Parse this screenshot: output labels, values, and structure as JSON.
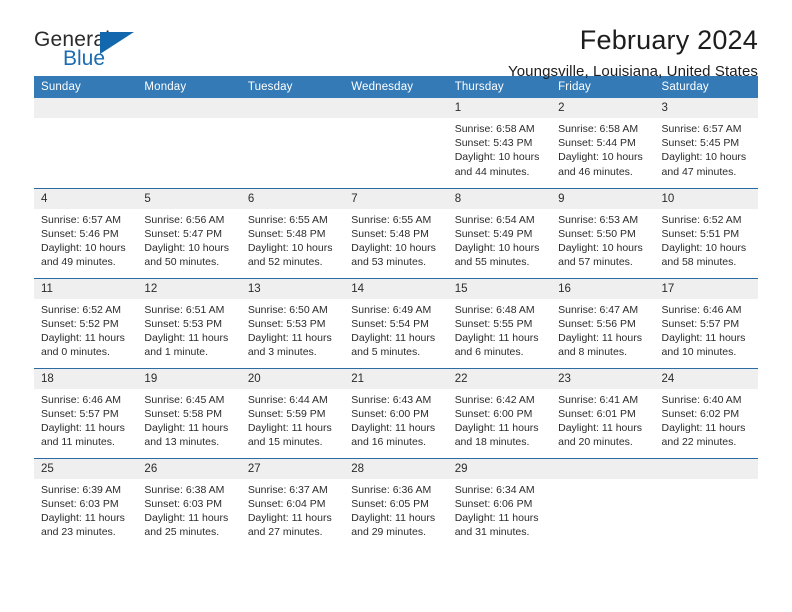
{
  "brand": {
    "name_line1": "General",
    "name_line2": "Blue",
    "logo_icon": "triangle-icon",
    "accent_color": "#1267ad"
  },
  "header": {
    "title": "February 2024",
    "subtitle": "Youngsville, Louisiana, United States"
  },
  "theme": {
    "header_row_bg": "#337ab7",
    "header_row_text": "#ffffff",
    "row_divider": "#2b6ca3",
    "daynum_bg": "#efefef",
    "body_text": "#2b2b2b"
  },
  "calendar": {
    "weekday_headers": [
      "Sunday",
      "Monday",
      "Tuesday",
      "Wednesday",
      "Thursday",
      "Friday",
      "Saturday"
    ],
    "labels": {
      "sunrise": "Sunrise:",
      "sunset": "Sunset:",
      "daylight": "Daylight:"
    },
    "weeks": [
      [
        {
          "day": "",
          "sunrise": "",
          "sunset": "",
          "daylight_line1": "",
          "daylight_line2": "",
          "empty": true
        },
        {
          "day": "",
          "sunrise": "",
          "sunset": "",
          "daylight_line1": "",
          "daylight_line2": "",
          "empty": true
        },
        {
          "day": "",
          "sunrise": "",
          "sunset": "",
          "daylight_line1": "",
          "daylight_line2": "",
          "empty": true
        },
        {
          "day": "",
          "sunrise": "",
          "sunset": "",
          "daylight_line1": "",
          "daylight_line2": "",
          "empty": true
        },
        {
          "day": "1",
          "sunrise": "Sunrise: 6:58 AM",
          "sunset": "Sunset: 5:43 PM",
          "daylight_line1": "Daylight: 10 hours",
          "daylight_line2": "and 44 minutes.",
          "empty": false
        },
        {
          "day": "2",
          "sunrise": "Sunrise: 6:58 AM",
          "sunset": "Sunset: 5:44 PM",
          "daylight_line1": "Daylight: 10 hours",
          "daylight_line2": "and 46 minutes.",
          "empty": false
        },
        {
          "day": "3",
          "sunrise": "Sunrise: 6:57 AM",
          "sunset": "Sunset: 5:45 PM",
          "daylight_line1": "Daylight: 10 hours",
          "daylight_line2": "and 47 minutes.",
          "empty": false
        }
      ],
      [
        {
          "day": "4",
          "sunrise": "Sunrise: 6:57 AM",
          "sunset": "Sunset: 5:46 PM",
          "daylight_line1": "Daylight: 10 hours",
          "daylight_line2": "and 49 minutes.",
          "empty": false
        },
        {
          "day": "5",
          "sunrise": "Sunrise: 6:56 AM",
          "sunset": "Sunset: 5:47 PM",
          "daylight_line1": "Daylight: 10 hours",
          "daylight_line2": "and 50 minutes.",
          "empty": false
        },
        {
          "day": "6",
          "sunrise": "Sunrise: 6:55 AM",
          "sunset": "Sunset: 5:48 PM",
          "daylight_line1": "Daylight: 10 hours",
          "daylight_line2": "and 52 minutes.",
          "empty": false
        },
        {
          "day": "7",
          "sunrise": "Sunrise: 6:55 AM",
          "sunset": "Sunset: 5:48 PM",
          "daylight_line1": "Daylight: 10 hours",
          "daylight_line2": "and 53 minutes.",
          "empty": false
        },
        {
          "day": "8",
          "sunrise": "Sunrise: 6:54 AM",
          "sunset": "Sunset: 5:49 PM",
          "daylight_line1": "Daylight: 10 hours",
          "daylight_line2": "and 55 minutes.",
          "empty": false
        },
        {
          "day": "9",
          "sunrise": "Sunrise: 6:53 AM",
          "sunset": "Sunset: 5:50 PM",
          "daylight_line1": "Daylight: 10 hours",
          "daylight_line2": "and 57 minutes.",
          "empty": false
        },
        {
          "day": "10",
          "sunrise": "Sunrise: 6:52 AM",
          "sunset": "Sunset: 5:51 PM",
          "daylight_line1": "Daylight: 10 hours",
          "daylight_line2": "and 58 minutes.",
          "empty": false
        }
      ],
      [
        {
          "day": "11",
          "sunrise": "Sunrise: 6:52 AM",
          "sunset": "Sunset: 5:52 PM",
          "daylight_line1": "Daylight: 11 hours",
          "daylight_line2": "and 0 minutes.",
          "empty": false
        },
        {
          "day": "12",
          "sunrise": "Sunrise: 6:51 AM",
          "sunset": "Sunset: 5:53 PM",
          "daylight_line1": "Daylight: 11 hours",
          "daylight_line2": "and 1 minute.",
          "empty": false
        },
        {
          "day": "13",
          "sunrise": "Sunrise: 6:50 AM",
          "sunset": "Sunset: 5:53 PM",
          "daylight_line1": "Daylight: 11 hours",
          "daylight_line2": "and 3 minutes.",
          "empty": false
        },
        {
          "day": "14",
          "sunrise": "Sunrise: 6:49 AM",
          "sunset": "Sunset: 5:54 PM",
          "daylight_line1": "Daylight: 11 hours",
          "daylight_line2": "and 5 minutes.",
          "empty": false
        },
        {
          "day": "15",
          "sunrise": "Sunrise: 6:48 AM",
          "sunset": "Sunset: 5:55 PM",
          "daylight_line1": "Daylight: 11 hours",
          "daylight_line2": "and 6 minutes.",
          "empty": false
        },
        {
          "day": "16",
          "sunrise": "Sunrise: 6:47 AM",
          "sunset": "Sunset: 5:56 PM",
          "daylight_line1": "Daylight: 11 hours",
          "daylight_line2": "and 8 minutes.",
          "empty": false
        },
        {
          "day": "17",
          "sunrise": "Sunrise: 6:46 AM",
          "sunset": "Sunset: 5:57 PM",
          "daylight_line1": "Daylight: 11 hours",
          "daylight_line2": "and 10 minutes.",
          "empty": false
        }
      ],
      [
        {
          "day": "18",
          "sunrise": "Sunrise: 6:46 AM",
          "sunset": "Sunset: 5:57 PM",
          "daylight_line1": "Daylight: 11 hours",
          "daylight_line2": "and 11 minutes.",
          "empty": false
        },
        {
          "day": "19",
          "sunrise": "Sunrise: 6:45 AM",
          "sunset": "Sunset: 5:58 PM",
          "daylight_line1": "Daylight: 11 hours",
          "daylight_line2": "and 13 minutes.",
          "empty": false
        },
        {
          "day": "20",
          "sunrise": "Sunrise: 6:44 AM",
          "sunset": "Sunset: 5:59 PM",
          "daylight_line1": "Daylight: 11 hours",
          "daylight_line2": "and 15 minutes.",
          "empty": false
        },
        {
          "day": "21",
          "sunrise": "Sunrise: 6:43 AM",
          "sunset": "Sunset: 6:00 PM",
          "daylight_line1": "Daylight: 11 hours",
          "daylight_line2": "and 16 minutes.",
          "empty": false
        },
        {
          "day": "22",
          "sunrise": "Sunrise: 6:42 AM",
          "sunset": "Sunset: 6:00 PM",
          "daylight_line1": "Daylight: 11 hours",
          "daylight_line2": "and 18 minutes.",
          "empty": false
        },
        {
          "day": "23",
          "sunrise": "Sunrise: 6:41 AM",
          "sunset": "Sunset: 6:01 PM",
          "daylight_line1": "Daylight: 11 hours",
          "daylight_line2": "and 20 minutes.",
          "empty": false
        },
        {
          "day": "24",
          "sunrise": "Sunrise: 6:40 AM",
          "sunset": "Sunset: 6:02 PM",
          "daylight_line1": "Daylight: 11 hours",
          "daylight_line2": "and 22 minutes.",
          "empty": false
        }
      ],
      [
        {
          "day": "25",
          "sunrise": "Sunrise: 6:39 AM",
          "sunset": "Sunset: 6:03 PM",
          "daylight_line1": "Daylight: 11 hours",
          "daylight_line2": "and 23 minutes.",
          "empty": false
        },
        {
          "day": "26",
          "sunrise": "Sunrise: 6:38 AM",
          "sunset": "Sunset: 6:03 PM",
          "daylight_line1": "Daylight: 11 hours",
          "daylight_line2": "and 25 minutes.",
          "empty": false
        },
        {
          "day": "27",
          "sunrise": "Sunrise: 6:37 AM",
          "sunset": "Sunset: 6:04 PM",
          "daylight_line1": "Daylight: 11 hours",
          "daylight_line2": "and 27 minutes.",
          "empty": false
        },
        {
          "day": "28",
          "sunrise": "Sunrise: 6:36 AM",
          "sunset": "Sunset: 6:05 PM",
          "daylight_line1": "Daylight: 11 hours",
          "daylight_line2": "and 29 minutes.",
          "empty": false
        },
        {
          "day": "29",
          "sunrise": "Sunrise: 6:34 AM",
          "sunset": "Sunset: 6:06 PM",
          "daylight_line1": "Daylight: 11 hours",
          "daylight_line2": "and 31 minutes.",
          "empty": false
        },
        {
          "day": "",
          "sunrise": "",
          "sunset": "",
          "daylight_line1": "",
          "daylight_line2": "",
          "empty": true
        },
        {
          "day": "",
          "sunrise": "",
          "sunset": "",
          "daylight_line1": "",
          "daylight_line2": "",
          "empty": true
        }
      ]
    ]
  }
}
